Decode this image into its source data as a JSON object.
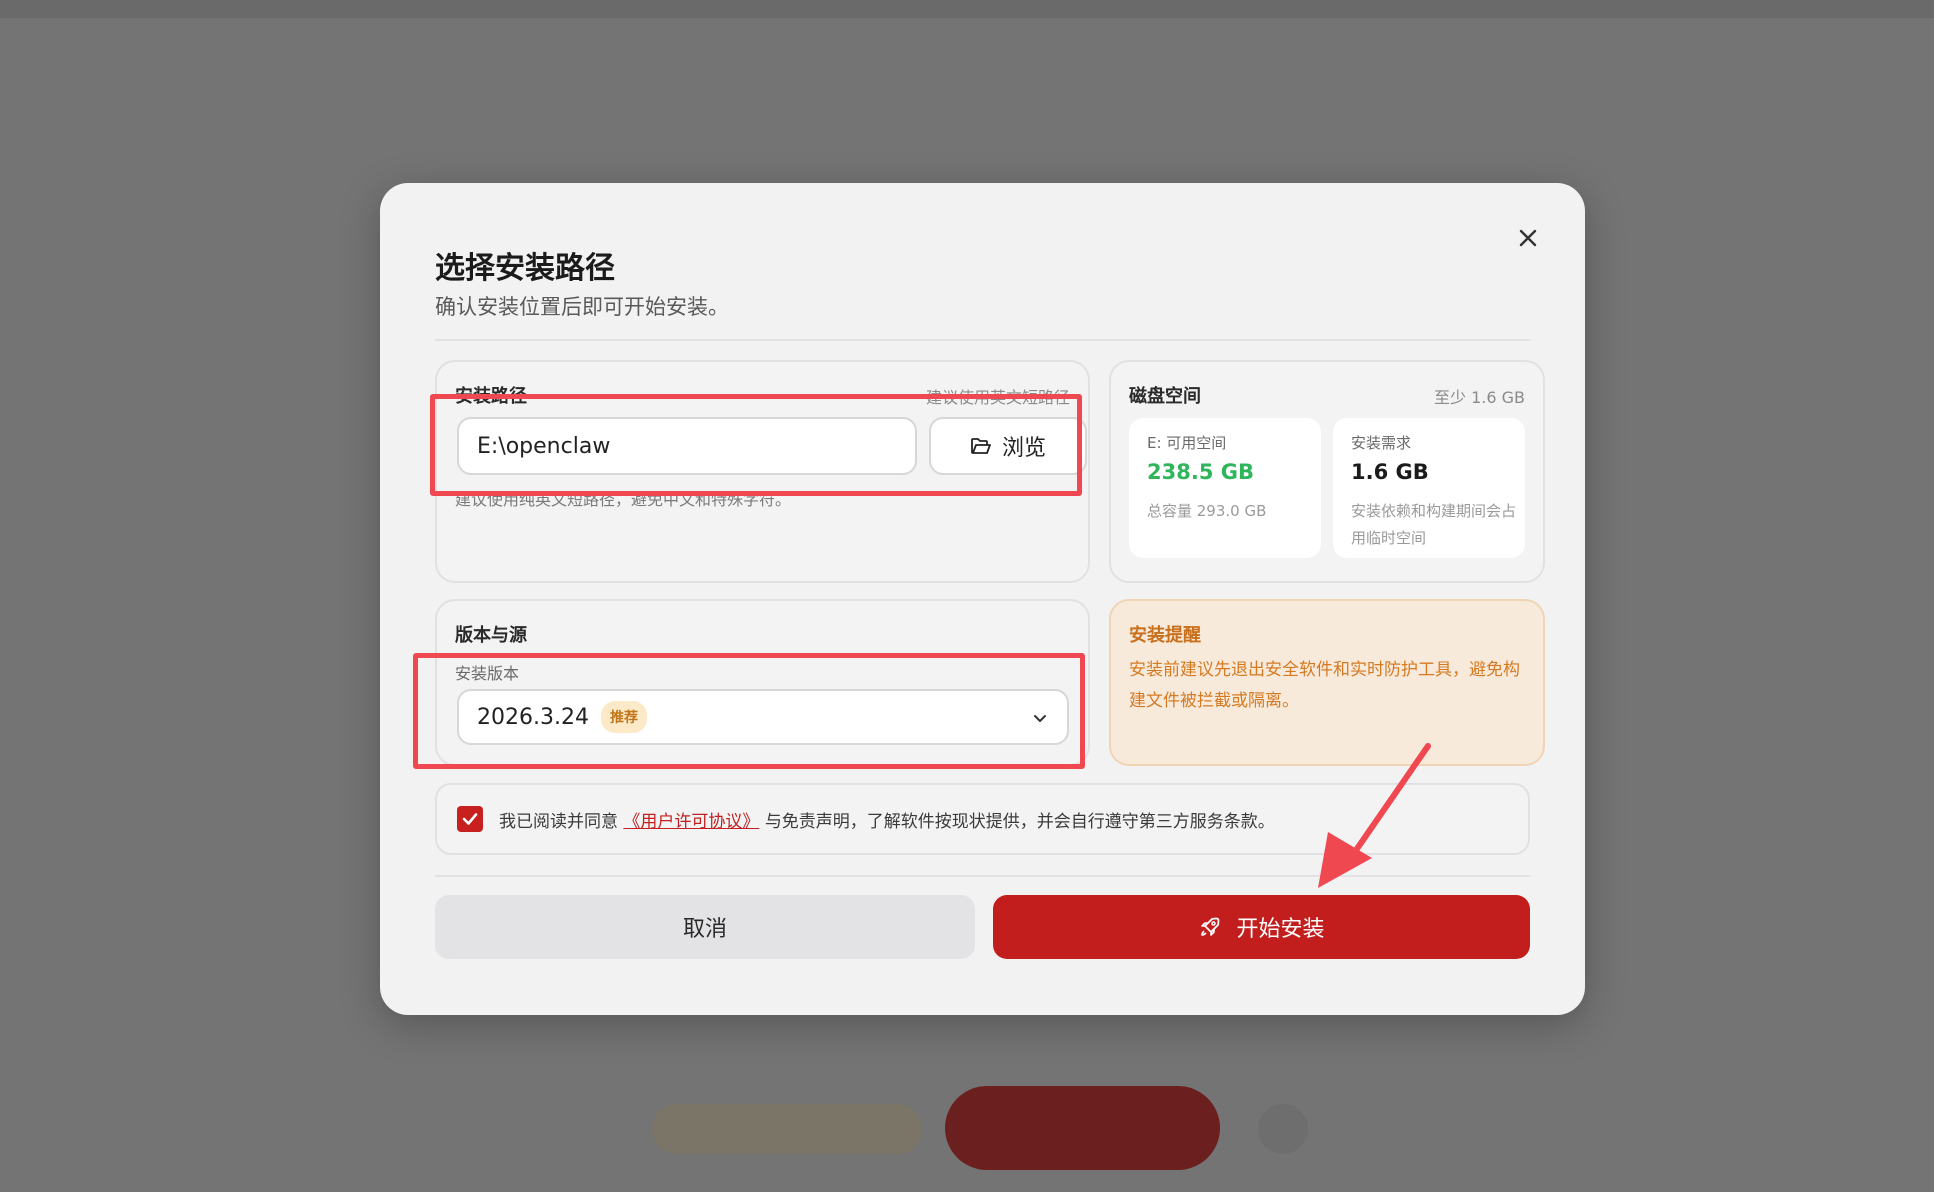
{
  "dialog": {
    "title": "选择安装路径",
    "subtitle": "确认安装位置后即可开始安装。"
  },
  "install_path": {
    "title": "安装路径",
    "hint": "建议使用英文短路径",
    "value": "E:\\openclaw",
    "browse_label": "浏览",
    "help": "建议使用纯英文短路径，避免中文和特殊字符。"
  },
  "disk": {
    "title": "磁盘空间",
    "hint": "至少 1.6 GB",
    "available": {
      "label": "E: 可用空间",
      "value": "238.5 GB",
      "sub": "总容量 293.0 GB"
    },
    "required": {
      "label": "安装需求",
      "value": "1.6 GB",
      "sub": "安装依赖和构建期间会占用临时空间"
    }
  },
  "version": {
    "title": "版本与源",
    "label": "安装版本",
    "selected": "2026.3.24",
    "badge": "推荐"
  },
  "warning": {
    "title": "安装提醒",
    "text": "安装前建议先退出安全软件和实时防护工具，避免构建文件被拦截或隔离。"
  },
  "agreement": {
    "checked": true,
    "prefix": "我已阅读并同意",
    "link": "《用户许可协议》",
    "suffix": "与免责声明，了解软件按现状提供，并会自行遵守第三方服务条款。"
  },
  "actions": {
    "cancel_label": "取消",
    "start_label": "开始安装"
  },
  "colors": {
    "accent": "#c31e1e",
    "available_green": "#2fb55a",
    "warning_orange": "#d67a22",
    "highlight_red": "#ef4850"
  }
}
